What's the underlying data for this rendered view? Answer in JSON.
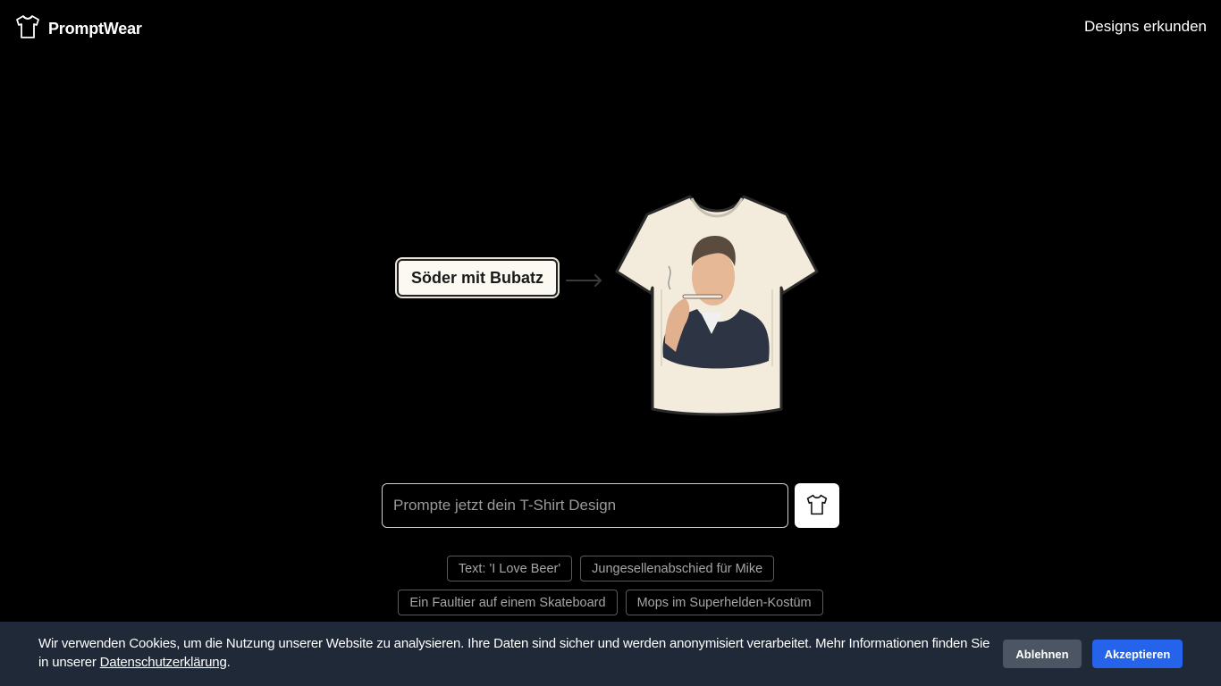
{
  "header": {
    "logo_icon": "tshirt-icon",
    "brand": "PromptWear",
    "nav_link": "Designs erkunden"
  },
  "hero": {
    "example_prompt": "Söder mit Bubatz",
    "arrow_icon": "arrow-right-icon",
    "shirt_image": "tshirt-preview-image"
  },
  "prompt": {
    "placeholder": "Prompte jetzt dein T-Shirt Design",
    "value": "",
    "button_icon": "tshirt-icon"
  },
  "suggestions": [
    [
      "Text: 'I Love Beer'",
      "Jungesellenabschied für Mike"
    ],
    [
      "Ein Faultier auf einem Skateboard",
      "Mops im Superhelden-Kostüm"
    ]
  ],
  "cookie": {
    "text": "Wir verwenden Cookies, um die Nutzung unserer Website zu analysieren. Ihre Daten sind sicher und werden anonymisiert verarbeitet. Mehr Informationen finden Sie in unserer ",
    "link": "Datenschutzerklärung",
    "text_end": ".",
    "decline": "Ablehnen",
    "accept": "Akzeptieren"
  },
  "colors": {
    "background": "#000000",
    "cookie_bar": "#1f2937",
    "accept": "#2563eb",
    "decline": "#4b5563",
    "shirt": "#f3ecdd"
  }
}
